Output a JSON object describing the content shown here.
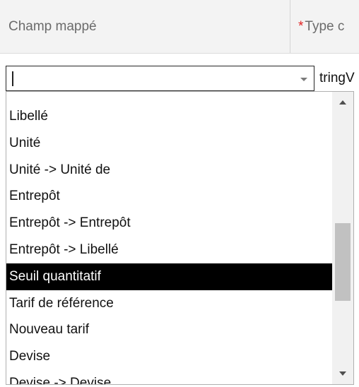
{
  "table": {
    "header": {
      "col1": "Champ mappé",
      "col2_required": "*",
      "col2": "Type c"
    },
    "neighbor_value": "tringV"
  },
  "select": {
    "value": "",
    "dropdown_open": true,
    "options": [
      "Libellé",
      "Unité",
      "Unité -> Unité de",
      "Entrepôt",
      "Entrepôt -> Entrepôt",
      "Entrepôt -> Libellé",
      "Seuil quantitatif",
      "Tarif de référence",
      "Nouveau tarif",
      "Devise",
      "Devise -> Devise"
    ],
    "selected_option": "Seuil quantitatif"
  },
  "colors": {
    "header_bg": "#f3f3f3",
    "header_text": "#6b6b6b",
    "required": "#e02020",
    "selected_bg": "#000000",
    "selected_text": "#ffffff"
  },
  "icons": {
    "select_caret": "chevron-down-icon",
    "scroll_up": "arrow-up-icon",
    "scroll_down": "arrow-down-icon"
  }
}
